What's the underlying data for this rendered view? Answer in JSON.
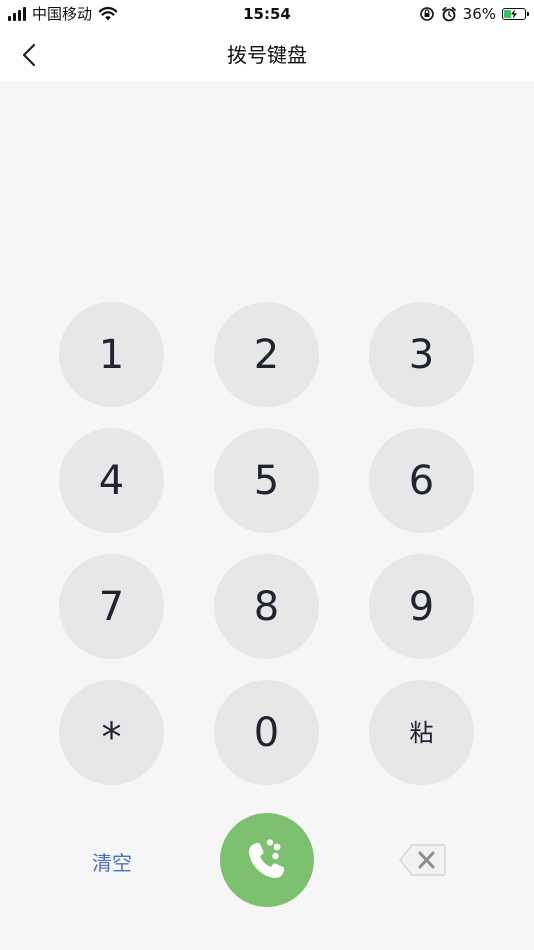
{
  "status_bar": {
    "carrier": "中国移动",
    "time": "15:54",
    "battery_percent": "36%",
    "battery_level": 0.36,
    "icons": [
      "signal-icon",
      "wifi-icon",
      "orientation-lock-icon",
      "alarm-icon",
      "battery-charging-icon"
    ]
  },
  "nav": {
    "title": "拨号键盘",
    "back_icon": "chevron-left-icon"
  },
  "keypad": {
    "keys": [
      "1",
      "2",
      "3",
      "4",
      "5",
      "6",
      "7",
      "8",
      "9",
      "*",
      "0",
      "粘"
    ]
  },
  "actions": {
    "clear_label": "清空",
    "call_icon": "phone-icon",
    "delete_icon": "backspace-icon"
  },
  "colors": {
    "background": "#f6f6f6",
    "key_background": "#e7e7e7",
    "call_green": "#7dc070",
    "clear_blue": "#4a6fcf",
    "key_text": "#1f2430"
  }
}
